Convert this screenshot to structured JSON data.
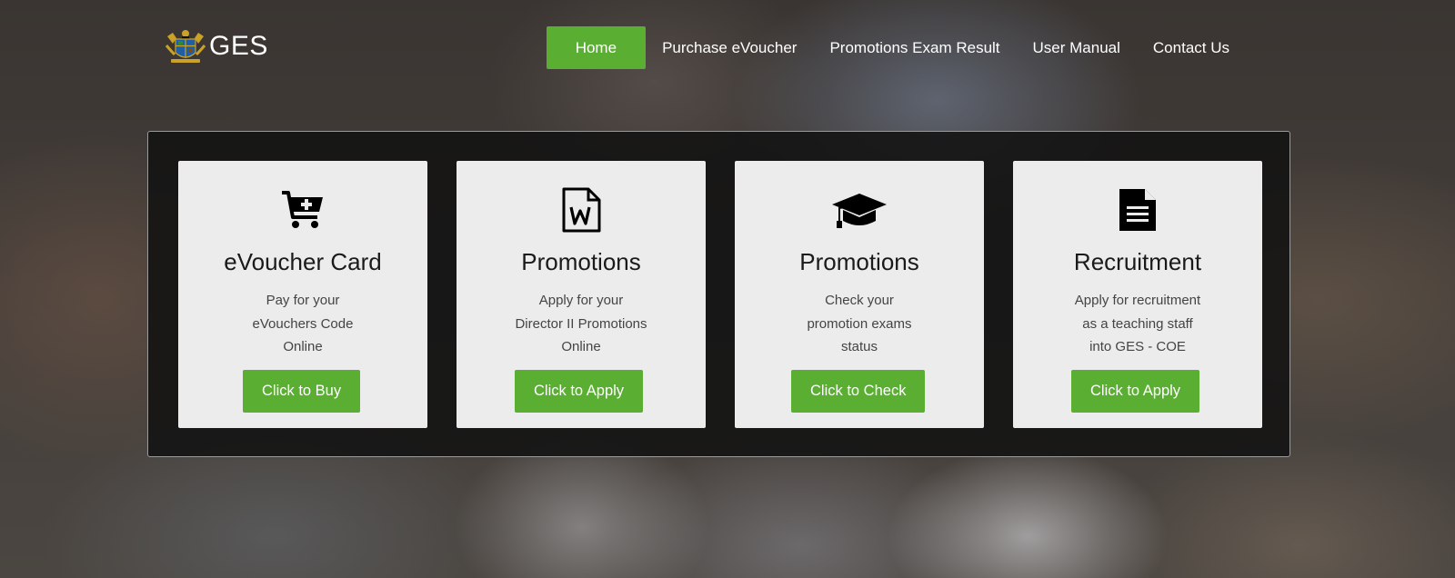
{
  "logo": {
    "text": "GES",
    "emblem_icon": "ghana-coat-of-arms-emblem"
  },
  "nav": {
    "items": [
      {
        "label": "Home",
        "active": true
      },
      {
        "label": "Purchase eVoucher",
        "active": false
      },
      {
        "label": "Promotions Exam Result",
        "active": false
      },
      {
        "label": "User Manual",
        "active": false
      },
      {
        "label": "Contact Us",
        "active": false
      }
    ]
  },
  "cards": [
    {
      "icon": "cart-plus-icon",
      "title": "eVoucher Card",
      "desc_lines": [
        "Pay for your",
        "eVouchers Code",
        "Online"
      ],
      "button": "Click to Buy"
    },
    {
      "icon": "word-file-icon",
      "title": "Promotions",
      "desc_lines": [
        "Apply for your",
        "Director II Promotions",
        "Online"
      ],
      "button": "Click to Apply"
    },
    {
      "icon": "graduation-cap-icon",
      "title": "Promotions",
      "desc_lines": [
        "Check your",
        "promotion exams",
        "status"
      ],
      "button": "Click to Check"
    },
    {
      "icon": "document-icon",
      "title": "Recruitment",
      "desc_lines": [
        "Apply for recruitment",
        "as a teaching staff",
        "into GES - COE"
      ],
      "button": "Click to Apply"
    }
  ],
  "colors": {
    "accent_green": "#5aae32",
    "card_bg": "#ececec",
    "panel_bg": "#121212"
  }
}
